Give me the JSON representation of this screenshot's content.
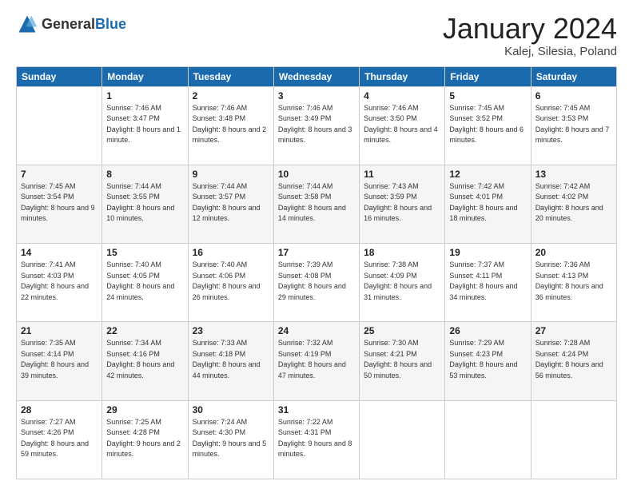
{
  "header": {
    "logo_general": "General",
    "logo_blue": "Blue",
    "title": "January 2024",
    "subtitle": "Kalej, Silesia, Poland"
  },
  "days_of_week": [
    "Sunday",
    "Monday",
    "Tuesday",
    "Wednesday",
    "Thursday",
    "Friday",
    "Saturday"
  ],
  "weeks": [
    [
      {
        "day": "",
        "sunrise": "",
        "sunset": "",
        "daylight": ""
      },
      {
        "day": "1",
        "sunrise": "Sunrise: 7:46 AM",
        "sunset": "Sunset: 3:47 PM",
        "daylight": "Daylight: 8 hours and 1 minute."
      },
      {
        "day": "2",
        "sunrise": "Sunrise: 7:46 AM",
        "sunset": "Sunset: 3:48 PM",
        "daylight": "Daylight: 8 hours and 2 minutes."
      },
      {
        "day": "3",
        "sunrise": "Sunrise: 7:46 AM",
        "sunset": "Sunset: 3:49 PM",
        "daylight": "Daylight: 8 hours and 3 minutes."
      },
      {
        "day": "4",
        "sunrise": "Sunrise: 7:46 AM",
        "sunset": "Sunset: 3:50 PM",
        "daylight": "Daylight: 8 hours and 4 minutes."
      },
      {
        "day": "5",
        "sunrise": "Sunrise: 7:45 AM",
        "sunset": "Sunset: 3:52 PM",
        "daylight": "Daylight: 8 hours and 6 minutes."
      },
      {
        "day": "6",
        "sunrise": "Sunrise: 7:45 AM",
        "sunset": "Sunset: 3:53 PM",
        "daylight": "Daylight: 8 hours and 7 minutes."
      }
    ],
    [
      {
        "day": "7",
        "sunrise": "Sunrise: 7:45 AM",
        "sunset": "Sunset: 3:54 PM",
        "daylight": "Daylight: 8 hours and 9 minutes."
      },
      {
        "day": "8",
        "sunrise": "Sunrise: 7:44 AM",
        "sunset": "Sunset: 3:55 PM",
        "daylight": "Daylight: 8 hours and 10 minutes."
      },
      {
        "day": "9",
        "sunrise": "Sunrise: 7:44 AM",
        "sunset": "Sunset: 3:57 PM",
        "daylight": "Daylight: 8 hours and 12 minutes."
      },
      {
        "day": "10",
        "sunrise": "Sunrise: 7:44 AM",
        "sunset": "Sunset: 3:58 PM",
        "daylight": "Daylight: 8 hours and 14 minutes."
      },
      {
        "day": "11",
        "sunrise": "Sunrise: 7:43 AM",
        "sunset": "Sunset: 3:59 PM",
        "daylight": "Daylight: 8 hours and 16 minutes."
      },
      {
        "day": "12",
        "sunrise": "Sunrise: 7:42 AM",
        "sunset": "Sunset: 4:01 PM",
        "daylight": "Daylight: 8 hours and 18 minutes."
      },
      {
        "day": "13",
        "sunrise": "Sunrise: 7:42 AM",
        "sunset": "Sunset: 4:02 PM",
        "daylight": "Daylight: 8 hours and 20 minutes."
      }
    ],
    [
      {
        "day": "14",
        "sunrise": "Sunrise: 7:41 AM",
        "sunset": "Sunset: 4:03 PM",
        "daylight": "Daylight: 8 hours and 22 minutes."
      },
      {
        "day": "15",
        "sunrise": "Sunrise: 7:40 AM",
        "sunset": "Sunset: 4:05 PM",
        "daylight": "Daylight: 8 hours and 24 minutes."
      },
      {
        "day": "16",
        "sunrise": "Sunrise: 7:40 AM",
        "sunset": "Sunset: 4:06 PM",
        "daylight": "Daylight: 8 hours and 26 minutes."
      },
      {
        "day": "17",
        "sunrise": "Sunrise: 7:39 AM",
        "sunset": "Sunset: 4:08 PM",
        "daylight": "Daylight: 8 hours and 29 minutes."
      },
      {
        "day": "18",
        "sunrise": "Sunrise: 7:38 AM",
        "sunset": "Sunset: 4:09 PM",
        "daylight": "Daylight: 8 hours and 31 minutes."
      },
      {
        "day": "19",
        "sunrise": "Sunrise: 7:37 AM",
        "sunset": "Sunset: 4:11 PM",
        "daylight": "Daylight: 8 hours and 34 minutes."
      },
      {
        "day": "20",
        "sunrise": "Sunrise: 7:36 AM",
        "sunset": "Sunset: 4:13 PM",
        "daylight": "Daylight: 8 hours and 36 minutes."
      }
    ],
    [
      {
        "day": "21",
        "sunrise": "Sunrise: 7:35 AM",
        "sunset": "Sunset: 4:14 PM",
        "daylight": "Daylight: 8 hours and 39 minutes."
      },
      {
        "day": "22",
        "sunrise": "Sunrise: 7:34 AM",
        "sunset": "Sunset: 4:16 PM",
        "daylight": "Daylight: 8 hours and 42 minutes."
      },
      {
        "day": "23",
        "sunrise": "Sunrise: 7:33 AM",
        "sunset": "Sunset: 4:18 PM",
        "daylight": "Daylight: 8 hours and 44 minutes."
      },
      {
        "day": "24",
        "sunrise": "Sunrise: 7:32 AM",
        "sunset": "Sunset: 4:19 PM",
        "daylight": "Daylight: 8 hours and 47 minutes."
      },
      {
        "day": "25",
        "sunrise": "Sunrise: 7:30 AM",
        "sunset": "Sunset: 4:21 PM",
        "daylight": "Daylight: 8 hours and 50 minutes."
      },
      {
        "day": "26",
        "sunrise": "Sunrise: 7:29 AM",
        "sunset": "Sunset: 4:23 PM",
        "daylight": "Daylight: 8 hours and 53 minutes."
      },
      {
        "day": "27",
        "sunrise": "Sunrise: 7:28 AM",
        "sunset": "Sunset: 4:24 PM",
        "daylight": "Daylight: 8 hours and 56 minutes."
      }
    ],
    [
      {
        "day": "28",
        "sunrise": "Sunrise: 7:27 AM",
        "sunset": "Sunset: 4:26 PM",
        "daylight": "Daylight: 8 hours and 59 minutes."
      },
      {
        "day": "29",
        "sunrise": "Sunrise: 7:25 AM",
        "sunset": "Sunset: 4:28 PM",
        "daylight": "Daylight: 9 hours and 2 minutes."
      },
      {
        "day": "30",
        "sunrise": "Sunrise: 7:24 AM",
        "sunset": "Sunset: 4:30 PM",
        "daylight": "Daylight: 9 hours and 5 minutes."
      },
      {
        "day": "31",
        "sunrise": "Sunrise: 7:22 AM",
        "sunset": "Sunset: 4:31 PM",
        "daylight": "Daylight: 9 hours and 8 minutes."
      },
      {
        "day": "",
        "sunrise": "",
        "sunset": "",
        "daylight": ""
      },
      {
        "day": "",
        "sunrise": "",
        "sunset": "",
        "daylight": ""
      },
      {
        "day": "",
        "sunrise": "",
        "sunset": "",
        "daylight": ""
      }
    ]
  ]
}
